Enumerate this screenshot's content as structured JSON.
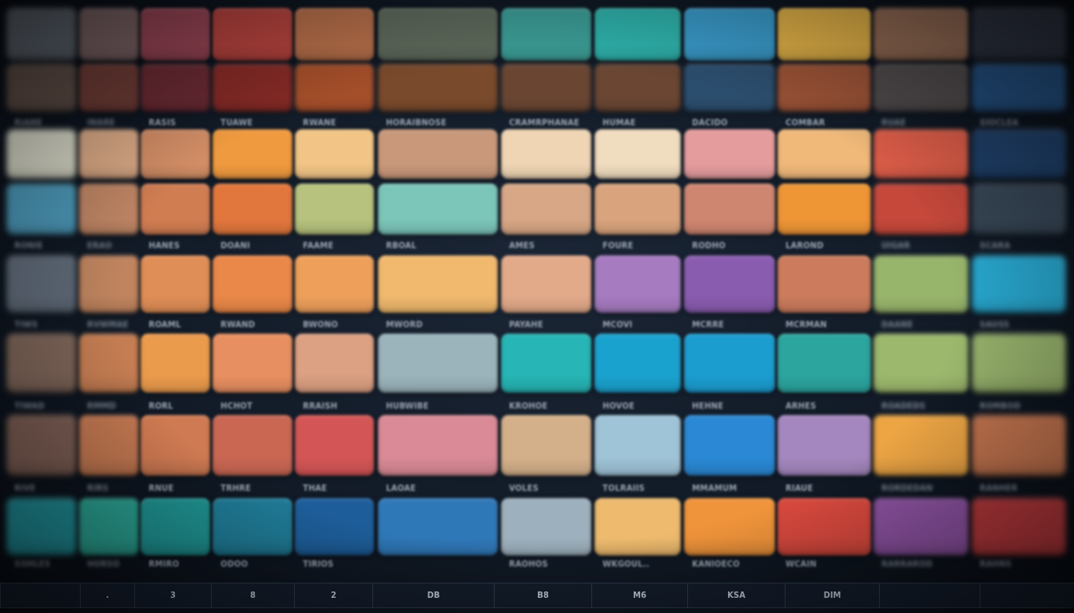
{
  "palette_rows": [
    {
      "name": "row-1",
      "colors": [
        "#5e6670",
        "#7d6467",
        "#9a4656",
        "#b9443f",
        "#b8704a",
        "#5e6a5c",
        "#3d9e98",
        "#2fb3ad",
        "#3a9ccc",
        "#e4b348",
        "#956c55",
        "#2e3442"
      ]
    },
    {
      "name": "row-2",
      "colors": [
        "#5e4d46",
        "#6e3c36",
        "#6a2a33",
        "#862a26",
        "#a44e2a",
        "#7a4a2c",
        "#6a4632",
        "#6a4633",
        "#2c4e6e",
        "#9a5236",
        "#4f4a4c",
        "#234f80"
      ]
    },
    {
      "name": "row-3",
      "colors": [
        "#d9dac9",
        "#dcab87",
        "#d38e66",
        "#f09a3f",
        "#f2c586",
        "#c9987b",
        "#efd5b4",
        "#f0dcbf",
        "#e59c9d",
        "#f0b97a",
        "#db5c48",
        "#1f406a"
      ]
    },
    {
      "name": "row-4",
      "colors": [
        "#4c98b8",
        "#c08665",
        "#d17d52",
        "#e2773d",
        "#b6c27d",
        "#7cc5b9",
        "#d7a786",
        "#d9a47d",
        "#cf8670",
        "#ee9536",
        "#c5483b",
        "#374656"
      ]
    },
    {
      "name": "row-5",
      "colors": [
        "#5f6a78",
        "#c0845f",
        "#e08e57",
        "#ea8849",
        "#eea05b",
        "#f0b96e",
        "#e3aa8a",
        "#a67bc0",
        "#8a5cb0",
        "#cc7c5d",
        "#98b56c",
        "#28a7cf"
      ]
    },
    {
      "name": "row-6",
      "colors": [
        "#7d6458",
        "#c57d52",
        "#eb9b4c",
        "#e88f61",
        "#dca082",
        "#9bb4bc",
        "#27b5b5",
        "#1aa2cf",
        "#1b9dd0",
        "#2ca59f",
        "#9cb86d",
        "#97b26c"
      ]
    },
    {
      "name": "row-7",
      "colors": [
        "#7a5c52",
        "#c27750",
        "#cf7a52",
        "#c96753",
        "#d45556",
        "#d98a96",
        "#d4b08a",
        "#9fc3d7",
        "#2a88d4",
        "#a487be",
        "#eda544",
        "#c3744e"
      ]
    },
    {
      "name": "row-8",
      "colors": [
        "#1f8c96",
        "#2aa091",
        "#1e9291",
        "#1f7a95",
        "#1d5d99",
        "#2f78b8",
        "#9db0bd",
        "#edba6e",
        "#f0943b",
        "#d9493e",
        "#8d52a2",
        "#b8383c"
      ]
    }
  ],
  "label_rows": [
    {
      "name": "labels-1",
      "texts": [
        "RIANE",
        "INARE",
        "RASIS",
        "TUAWE",
        "RWANE",
        "HORAIBNOSE",
        "CRAMRPHANAE",
        "HUMAE",
        "DACIDO",
        "COMBAR",
        "RUAE",
        "SIOCLEA"
      ]
    },
    {
      "name": "labels-2",
      "texts": [
        "RONIE",
        "ERAO",
        "HANES",
        "DOANI",
        "FAAME",
        "RBOAL",
        "AMES",
        "FOURE",
        "RODHO",
        "LAROND",
        "UIGAR",
        "SCARA"
      ]
    },
    {
      "name": "labels-3",
      "texts": [
        "TIWS",
        "RVWMAE",
        "ROAML",
        "RWAND",
        "BWONO",
        "MWORD",
        "PAYAHE",
        "MCOVI",
        "MCRRE",
        "MCRMAN",
        "DAANE",
        "SAUSS"
      ]
    },
    {
      "name": "labels-4",
      "texts": [
        "TIWAD",
        "RMMD",
        "RORL",
        "HCHOT",
        "RRAISH",
        "HUBWIBE",
        "KROHOE",
        "HOVOE",
        "HEHNE",
        "ARHES",
        "ROADEDS",
        "ROMBOD"
      ]
    },
    {
      "name": "labels-5",
      "texts": [
        "RIVE",
        "RIRS",
        "RNUE",
        "TRHRE",
        "THAE",
        "LAOAE",
        "VOLES",
        "TOLRAIIS",
        "MMAMUM",
        "RIAUE",
        "RORDEDAN",
        "RANHER"
      ]
    },
    {
      "name": "labels-6",
      "texts": [
        "SOHLES",
        "HORSO",
        "RMIRO",
        "ODOO",
        "TIRIOS",
        "",
        "RAOHOS",
        "WKGOUL..",
        "KANIOECO",
        "WCAIN",
        "RARRAROD",
        "RAHNS"
      ]
    }
  ],
  "bottom_bar": [
    "",
    ".",
    "3",
    "8",
    "2",
    "DB",
    "B8",
    "M6",
    "KSA",
    "DIM",
    "",
    ""
  ]
}
